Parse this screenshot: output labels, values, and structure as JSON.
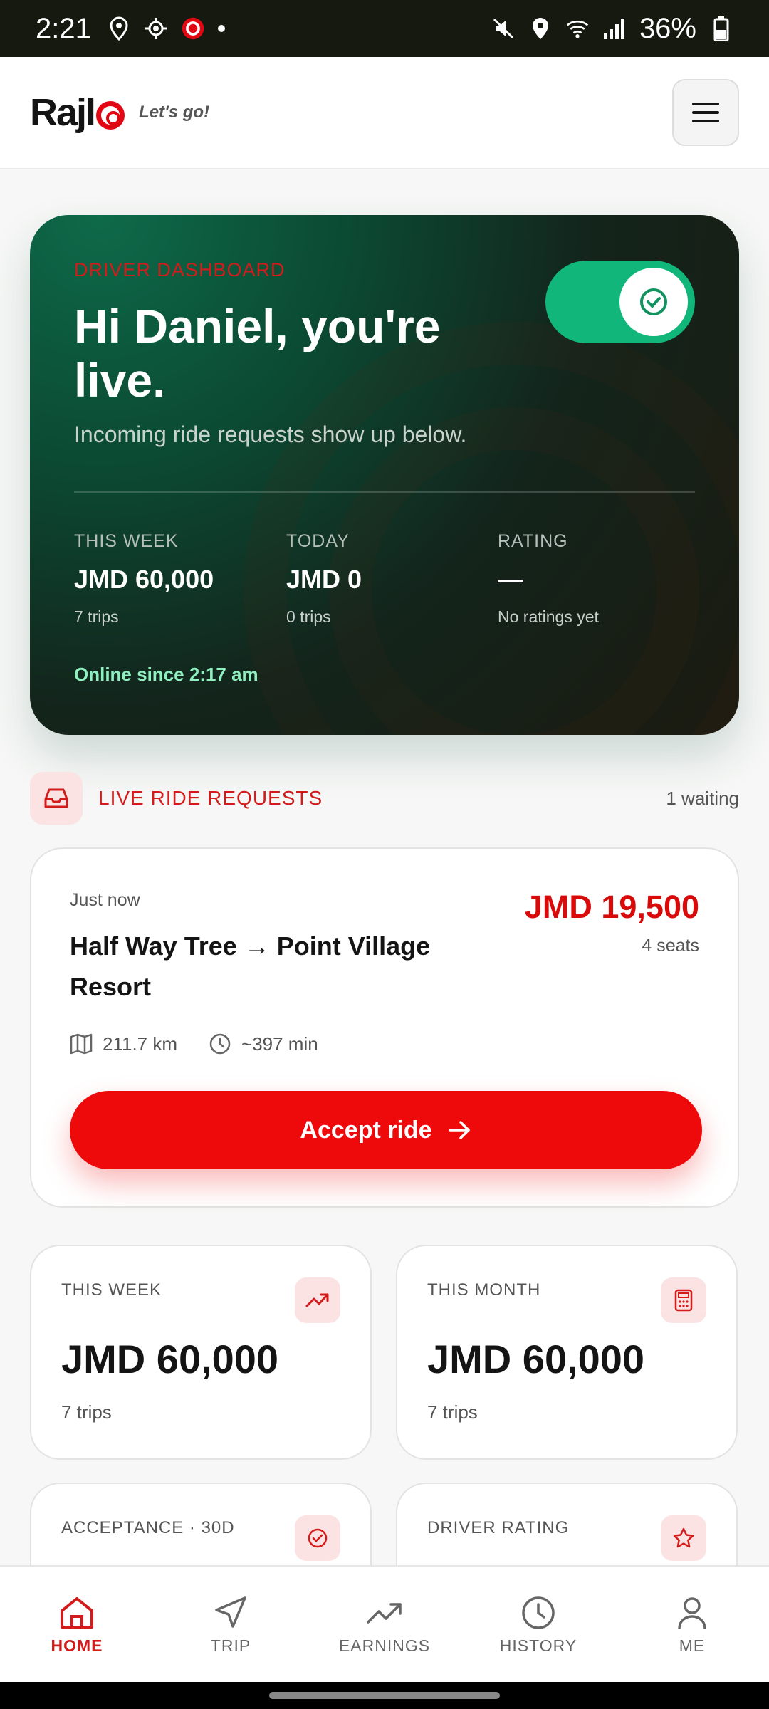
{
  "status_bar": {
    "time": "2:21",
    "battery": "36%"
  },
  "header": {
    "brand": "Rajl",
    "tagline": "Let's go!"
  },
  "hero": {
    "eyebrow": "DRIVER DASHBOARD",
    "title": "Hi Daniel, you're live.",
    "subtitle": "Incoming ride requests show up below.",
    "online_toggle_on": true,
    "stats": [
      {
        "label": "THIS WEEK",
        "value": "JMD 60,000",
        "sub": "7 trips"
      },
      {
        "label": "TODAY",
        "value": "JMD 0",
        "sub": "0 trips"
      },
      {
        "label": "RATING",
        "value": "—",
        "sub": "No ratings yet"
      }
    ],
    "online_since": "Online since 2:17 am"
  },
  "requests": {
    "title": "LIVE RIDE REQUESTS",
    "waiting": "1 waiting",
    "ride": {
      "time": "Just now",
      "route": "Half Way Tree → Point Village Resort",
      "price": "JMD 19,500",
      "seats": "4 seats",
      "distance": "211.7 km",
      "duration": "~397 min",
      "accept_label": "Accept ride"
    }
  },
  "cards": [
    {
      "label": "THIS WEEK",
      "value": "JMD 60,000",
      "sub": "7 trips",
      "icon": "trending-up-icon"
    },
    {
      "label": "THIS MONTH",
      "value": "JMD 60,000",
      "sub": "7 trips",
      "icon": "calculator-icon"
    },
    {
      "label": "ACCEPTANCE · 30D",
      "icon": "check-circle-icon"
    },
    {
      "label": "DRIVER RATING",
      "icon": "star-icon"
    }
  ],
  "nav": [
    {
      "label": "HOME",
      "active": true
    },
    {
      "label": "TRIP"
    },
    {
      "label": "EARNINGS"
    },
    {
      "label": "HISTORY"
    },
    {
      "label": "ME"
    }
  ],
  "colors": {
    "accent": "#e30613",
    "online_green": "#10b67a",
    "hero_dark": "#13241b"
  }
}
